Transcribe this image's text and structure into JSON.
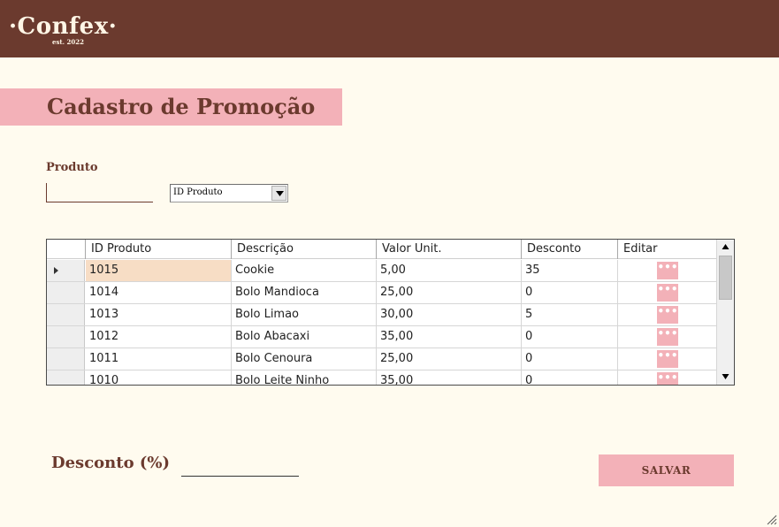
{
  "brand": {
    "name": "·Confex·",
    "tagline": "est. 2022"
  },
  "colors": {
    "primary": "#6B3A2E",
    "accent": "#F3B1B8",
    "background": "#FFFBEF",
    "selected_cell": "#F7DDC5"
  },
  "page": {
    "title": "Cadastro de Promoção"
  },
  "produto": {
    "label": "Produto",
    "input_value": "",
    "filter_selected": "ID Produto"
  },
  "grid": {
    "columns": [
      "ID Produto",
      "Descrição",
      "Valor Unit.",
      "Desconto",
      "Editar"
    ],
    "rows": [
      {
        "id": "1015",
        "descricao": "Cookie",
        "valor": "5,00",
        "desconto": "35",
        "editar": "•••"
      },
      {
        "id": "1014",
        "descricao": "Bolo Mandioca",
        "valor": "25,00",
        "desconto": "0",
        "editar": "•••"
      },
      {
        "id": "1013",
        "descricao": "Bolo Limao",
        "valor": "30,00",
        "desconto": "5",
        "editar": "•••"
      },
      {
        "id": "1012",
        "descricao": "Bolo Abacaxi",
        "valor": "35,00",
        "desconto": "0",
        "editar": "•••"
      },
      {
        "id": "1011",
        "descricao": "Bolo Cenoura",
        "valor": "25,00",
        "desconto": "0",
        "editar": "•••"
      },
      {
        "id": "1010",
        "descricao": "Bolo Leite Ninho",
        "valor": "35,00",
        "desconto": "0",
        "editar": "•••"
      }
    ],
    "icons": {
      "current_row": "row-pointer-icon",
      "scroll_up": "scroll-up-icon",
      "scroll_down": "scroll-down-icon"
    }
  },
  "desconto": {
    "label": "Desconto (%)",
    "input_value": ""
  },
  "actions": {
    "save_label": "SALVAR"
  }
}
